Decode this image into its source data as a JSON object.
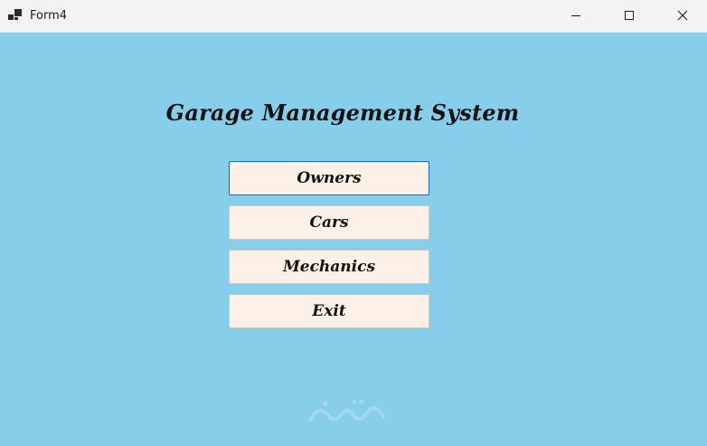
{
  "window": {
    "title": "Form4",
    "icon": "app-window-icon"
  },
  "caption_buttons": {
    "minimize_icon": "minimize-icon",
    "maximize_icon": "maximize-icon",
    "close_icon": "close-icon"
  },
  "main": {
    "heading": "Garage Management System",
    "buttons": [
      {
        "label": "Owners",
        "focused": true
      },
      {
        "label": "Cars",
        "focused": false
      },
      {
        "label": "Mechanics",
        "focused": false
      },
      {
        "label": "Exit",
        "focused": false
      }
    ]
  },
  "colors": {
    "client_background": "#87ceeb",
    "button_background": "#fdf1e7",
    "focused_border": "#1f6fb2"
  }
}
